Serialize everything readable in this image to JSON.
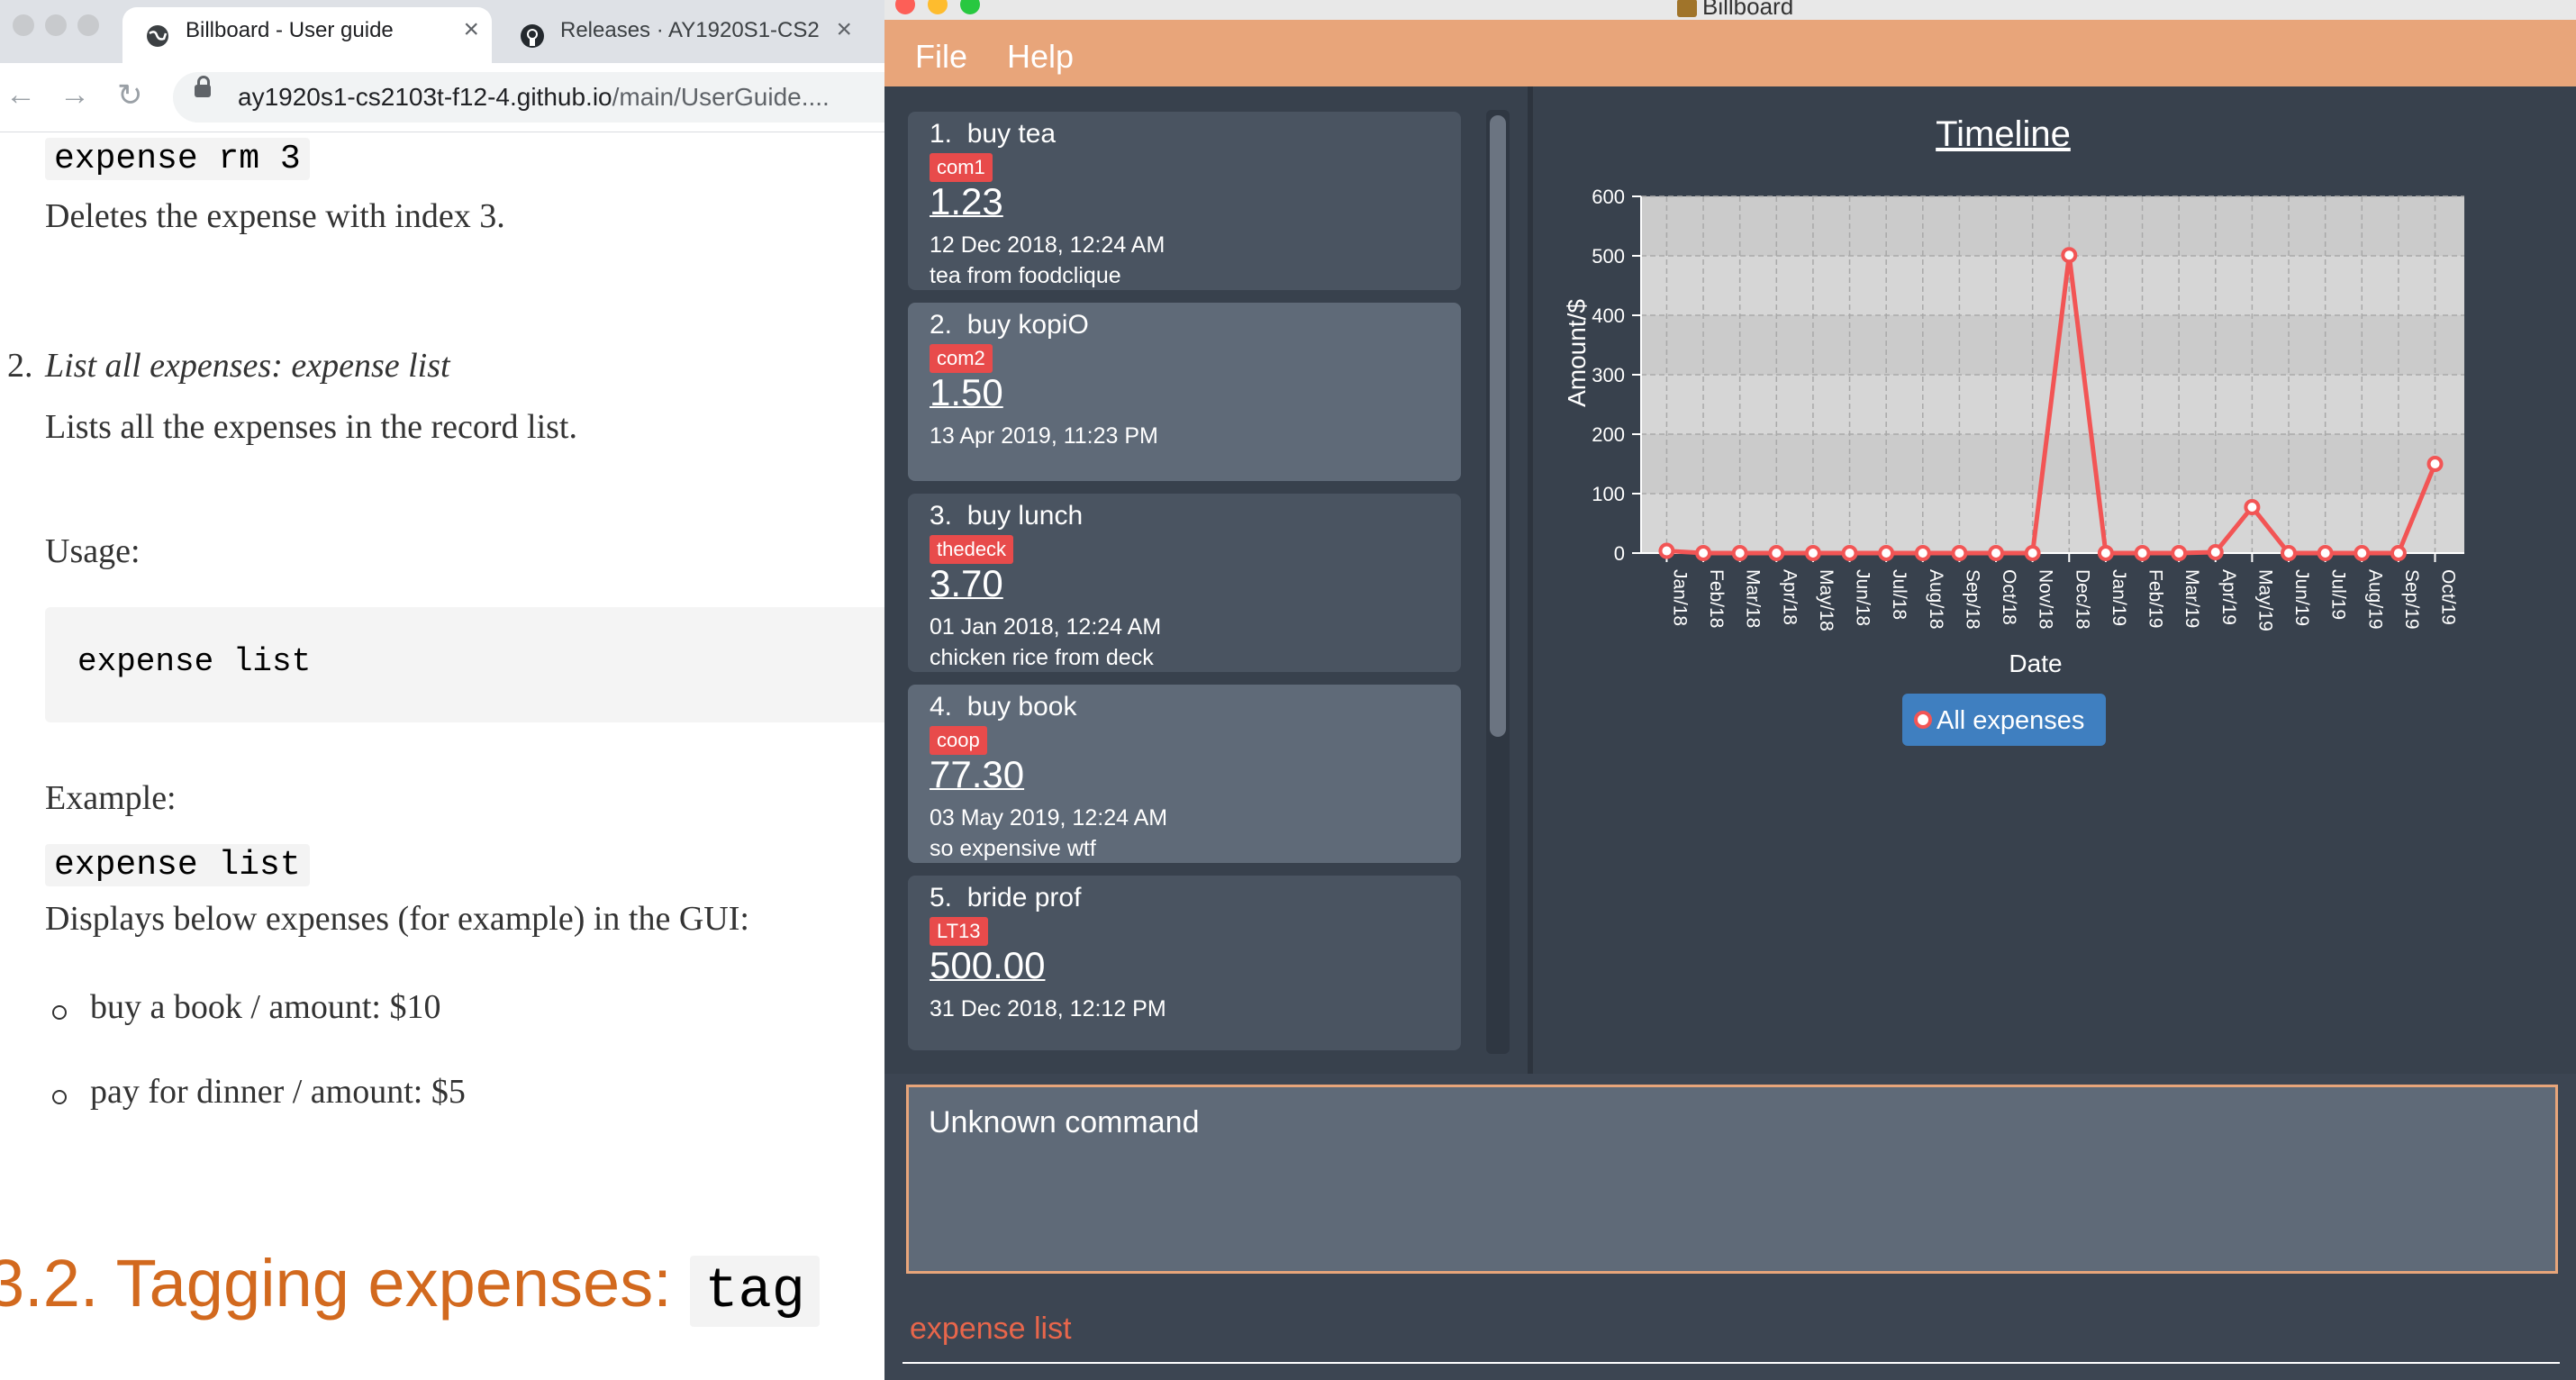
{
  "browser": {
    "tabs": [
      {
        "title": "Billboard - User guide",
        "icon": "globe-icon",
        "active": true
      },
      {
        "title": "Releases · AY1920S1-CS2",
        "icon": "github-icon",
        "active": false
      }
    ],
    "url_host": "ay1920s1-cs2103t-f12-4.github.io",
    "url_path": "/main/UserGuide...."
  },
  "doc": {
    "cmd_rm": "expense rm 3",
    "rm_desc": "Deletes the expense with index 3.",
    "list_item_number": "2.",
    "list_item_heading": "List all expenses: expense list",
    "list_desc": "Lists all the expenses in the record list.",
    "usage_label": "Usage:",
    "usage_code": "expense list",
    "example_label": "Example:",
    "example_code": "expense list",
    "example_desc": "Displays below expenses (for example) in the GUI:",
    "bullets": [
      "buy a book / amount: $10",
      "pay for dinner / amount: $5"
    ],
    "section_number": "3.2. Tagging expenses:",
    "section_code": "tag"
  },
  "app": {
    "window_title": "Billboard",
    "menu": [
      "File",
      "Help"
    ],
    "expenses": [
      {
        "index": "1.",
        "name": "buy tea",
        "tag": "com1",
        "amount": "1.23",
        "date": "12 Dec 2018, 12:24 AM",
        "description": "tea from foodclique"
      },
      {
        "index": "2.",
        "name": "buy kopiO",
        "tag": "com2",
        "amount": "1.50",
        "date": "13 Apr 2019, 11:23 PM",
        "description": ""
      },
      {
        "index": "3.",
        "name": "buy lunch",
        "tag": "thedeck",
        "amount": "3.70",
        "date": "01 Jan 2018, 12:24 AM",
        "description": "chicken rice from deck"
      },
      {
        "index": "4.",
        "name": "buy book",
        "tag": "coop",
        "amount": "77.30",
        "date": "03 May 2019, 12:24 AM",
        "description": "so expensive wtf"
      },
      {
        "index": "5.",
        "name": "bride prof",
        "tag": "LT13",
        "amount": "500.00",
        "date": "31 Dec 2018, 12:12 PM",
        "description": ""
      }
    ],
    "result_text": "Unknown command",
    "command_text": "expense list",
    "colors": {
      "accent": "#e8a57a",
      "tag": "#e84b4b",
      "line": "#f25555",
      "legend_bg": "#3f7fc0"
    }
  },
  "chart_data": {
    "type": "line",
    "title": "Timeline",
    "xlabel": "Date",
    "ylabel": "Amount/$",
    "ylim": [
      0,
      600
    ],
    "yticks": [
      0,
      100,
      200,
      300,
      400,
      500,
      600
    ],
    "x": [
      "Jan/18",
      "Feb/18",
      "Mar/18",
      "Apr/18",
      "May/18",
      "Jun/18",
      "Jul/18",
      "Aug/18",
      "Sep/18",
      "Oct/18",
      "Nov/18",
      "Dec/18",
      "Jan/19",
      "Feb/19",
      "Mar/19",
      "Apr/19",
      "May/19",
      "Jun/19",
      "Jul/19",
      "Aug/19",
      "Sep/19",
      "Oct/19"
    ],
    "series": [
      {
        "name": "All expenses",
        "values": [
          3.7,
          0,
          0,
          0,
          0,
          0,
          0,
          0,
          0,
          0,
          0,
          501.23,
          0,
          0,
          0,
          1.5,
          77.3,
          0,
          0,
          0,
          0,
          150
        ]
      }
    ],
    "grid": true,
    "legend": "bottom-center"
  }
}
